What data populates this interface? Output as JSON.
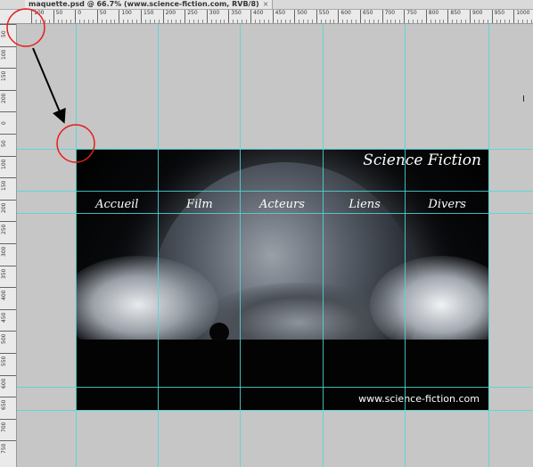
{
  "document": {
    "tab_title": "maquette.psd @ 66.7% (www.science-fiction.com, RVB/8)",
    "close_label": "×"
  },
  "rulers": {
    "horizontal_labels": [
      "100",
      "50",
      "0",
      "50",
      "100",
      "150",
      "200",
      "250",
      "300",
      "350",
      "400",
      "450",
      "500",
      "550",
      "600",
      "650",
      "700",
      "750",
      "800",
      "850",
      "900",
      "950",
      "1000"
    ],
    "vertical_labels": [
      "50",
      "100",
      "150",
      "200",
      "0",
      "50",
      "100",
      "150",
      "200",
      "250",
      "300",
      "350",
      "400",
      "450",
      "500",
      "550",
      "600",
      "650",
      "700",
      "750"
    ]
  },
  "artwork": {
    "site_title": "Science Fiction",
    "nav": [
      "Accueil",
      "Film",
      "Acteurs",
      "Liens",
      "Divers"
    ],
    "footer_url": "www.science-fiction.com"
  },
  "colors": {
    "guide": "#4fd8d8",
    "annotation": "#e81c1c",
    "canvas_bg": "#c6c6c6"
  },
  "icons": {
    "ruler_origin": "crosshair-icon",
    "cursor": "i-beam-cursor-icon"
  }
}
